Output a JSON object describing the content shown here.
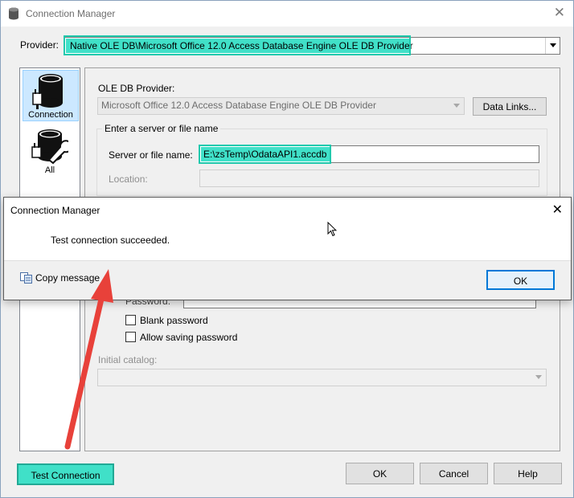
{
  "window": {
    "title": "Connection Manager",
    "close_glyph": "✕"
  },
  "provider": {
    "label": "Provider:",
    "value": "Native OLE DB\\Microsoft Office 12.0 Access Database Engine OLE DB Provider"
  },
  "sidebar": {
    "items": [
      {
        "label": "Connection",
        "icon": "database-plug-icon",
        "selected": true
      },
      {
        "label": "All",
        "icon": "database-wrench-icon",
        "selected": false
      }
    ]
  },
  "panel": {
    "ole_db_provider_label": "OLE DB Provider:",
    "ole_db_provider_value": "Microsoft Office 12.0 Access Database Engine OLE DB Provider",
    "data_links_button": "Data Links...",
    "server_group_label": "Enter a server or file name",
    "server_label": "Server or file name:",
    "server_value": "E:\\zsTemp\\OdataAPI1.accdb",
    "location_label": "Location:",
    "password_label": "Password:",
    "blank_password": "Blank password",
    "allow_saving_password": "Allow saving password",
    "initial_catalog_label": "Initial catalog:"
  },
  "footer": {
    "test_connection": "Test Connection",
    "ok": "OK",
    "cancel": "Cancel",
    "help": "Help"
  },
  "dialog": {
    "title": "Connection Manager",
    "close_glyph": "✕",
    "message": "Test connection succeeded.",
    "copy_message": "Copy message",
    "ok": "OK"
  },
  "colors": {
    "highlight": "#40e0c8",
    "arrow": "#e8413a",
    "selection": "#cce8ff",
    "accent": "#0078d7"
  }
}
